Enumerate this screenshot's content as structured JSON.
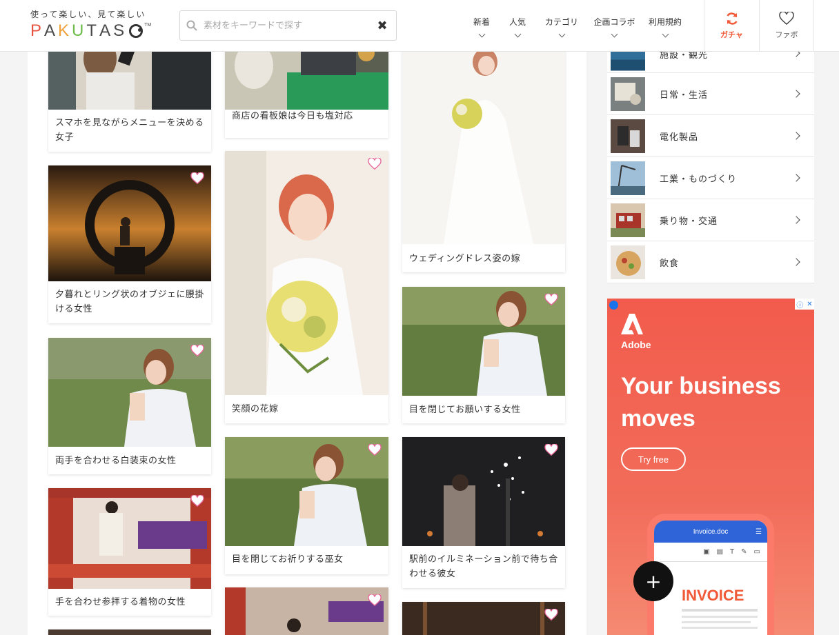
{
  "header": {
    "tagline": "使って楽しい、見て楽しい",
    "logo": {
      "p": "P",
      "a1": "A",
      "k": "K",
      "u": "U",
      "t": "T",
      "a2": "A",
      "s": "S",
      "tm": "TM"
    },
    "search_placeholder": "素材をキーワードで探す",
    "nav": [
      {
        "label": "新着"
      },
      {
        "label": "人気"
      },
      {
        "label": "カテゴリ"
      },
      {
        "label": "企画コラボ"
      },
      {
        "label": "利用規約"
      }
    ],
    "gacha_label": "ガチャ",
    "fav_label": "ファボ"
  },
  "colors": {
    "accent": "#f05a38",
    "heart": "#e8669a"
  },
  "cards": [
    {
      "caption": "スマホを見ながらメニューを決める女子"
    },
    {
      "caption": "夕暮れとリング状のオブジェに腰掛ける女性"
    },
    {
      "caption": "両手を合わせる白装束の女性"
    },
    {
      "caption": "手を合わせ参拝する着物の女性"
    },
    {
      "caption": "商店の看板娘は今日も塩対応"
    },
    {
      "caption": "笑顔の花嫁"
    },
    {
      "caption": "目を閉じてお祈りする巫女"
    },
    {
      "caption": "ウェディングドレス姿の嫁"
    },
    {
      "caption": "目を閉じてお願いする女性"
    },
    {
      "caption": "駅前のイルミネーション前で待ち合わせる彼女"
    }
  ],
  "sidebar": {
    "categories": [
      {
        "label": "施設・観光"
      },
      {
        "label": "日常・生活"
      },
      {
        "label": "電化製品"
      },
      {
        "label": "工業・ものづくり"
      },
      {
        "label": "乗り物・交通"
      },
      {
        "label": "飲食"
      }
    ]
  },
  "ad": {
    "brand": "Adobe",
    "headline_1": "Your business",
    "headline_2": "moves",
    "cta": "Try free",
    "doc_title": "Invoice.doc",
    "invoice_label": "INVOICE",
    "plus": "+"
  }
}
